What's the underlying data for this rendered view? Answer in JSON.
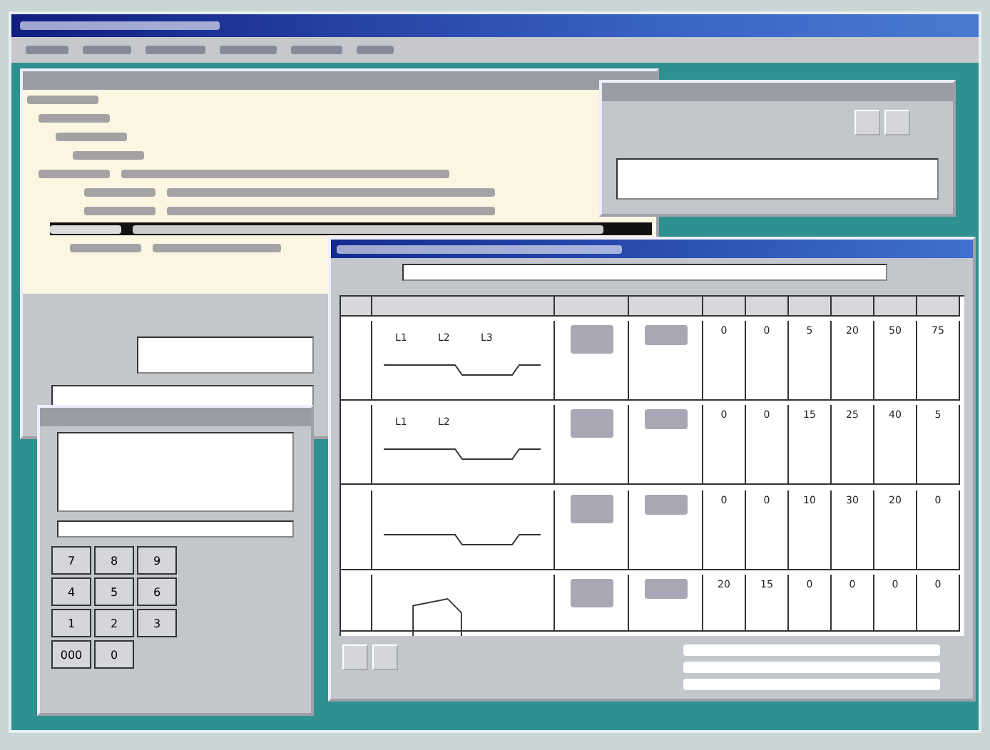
{
  "tree": {
    "rows": [
      {
        "selected": false
      },
      {
        "selected": false
      },
      {
        "selected": false
      },
      {
        "selected": false
      },
      {
        "selected": false
      },
      {
        "selected": false
      },
      {
        "selected": false
      },
      {
        "selected": true
      },
      {
        "selected": false
      }
    ]
  },
  "table": {
    "rows": [
      {
        "sketch_labels": [
          "L1",
          "L2",
          "L3"
        ],
        "values": [
          "0",
          "0",
          "5",
          "20",
          "50",
          "75"
        ]
      },
      {
        "sketch_labels": [
          "L1",
          "L2"
        ],
        "values": [
          "0",
          "0",
          "15",
          "25",
          "40",
          "5"
        ]
      },
      {
        "sketch_labels": [],
        "values": [
          "0",
          "0",
          "10",
          "30",
          "20",
          "0"
        ]
      },
      {
        "sketch_labels": [],
        "values": [
          "20",
          "15",
          "0",
          "0",
          "0",
          "0"
        ]
      }
    ]
  },
  "calculator": {
    "keys": [
      "7",
      "8",
      "9",
      "4",
      "5",
      "6",
      "1",
      "2",
      "3",
      "000",
      "0"
    ]
  }
}
